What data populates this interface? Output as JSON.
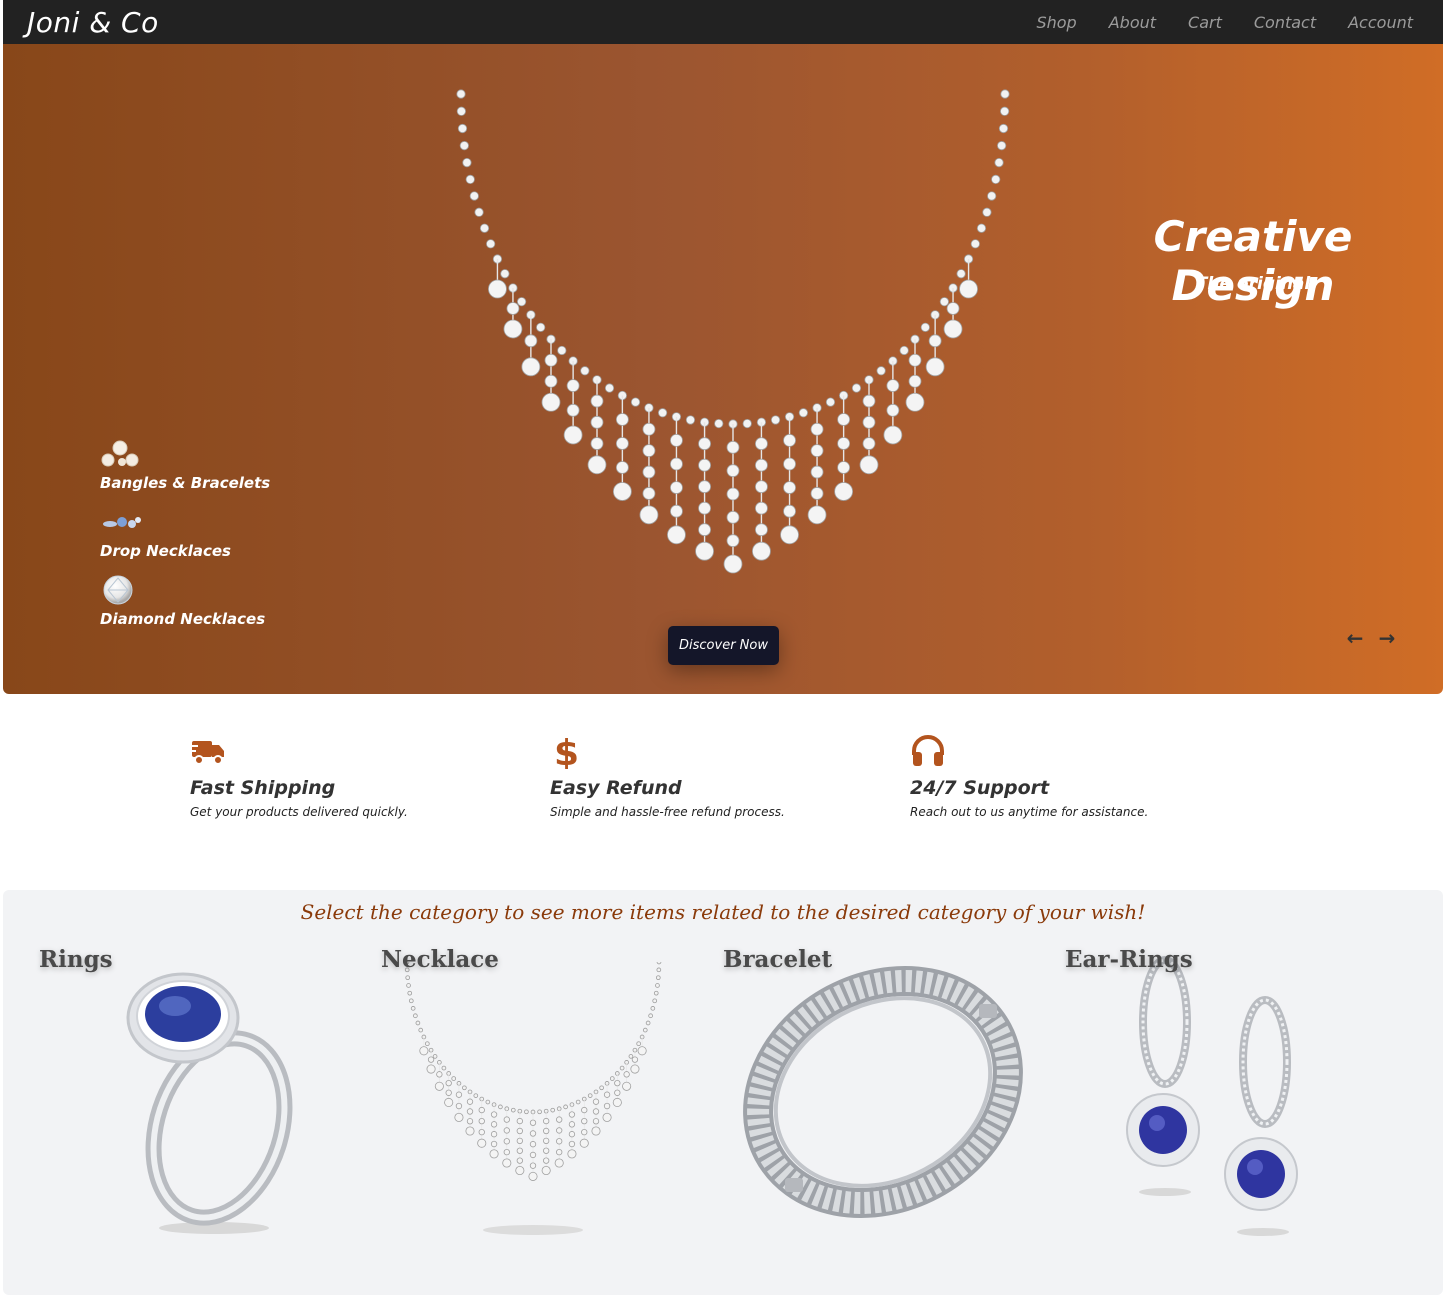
{
  "navbar": {
    "brand": "Joni & Co",
    "links": [
      "Shop",
      "About",
      "Cart",
      "Contact",
      "Account"
    ]
  },
  "hero": {
    "title": "Creative Design",
    "subtitle": "The original",
    "categories": [
      {
        "label": "Bangles & Bracelets",
        "icon": "pearls-icon"
      },
      {
        "label": "Drop Necklaces",
        "icon": "gem-cluster-icon"
      },
      {
        "label": "Diamond Necklaces",
        "icon": "diamond-icon"
      }
    ],
    "cta": "Discover Now",
    "prev_icon": "arrow-left-icon",
    "next_icon": "arrow-right-icon",
    "gradient": [
      "#884719",
      "#d06d26"
    ]
  },
  "features": [
    {
      "icon": "truck-icon",
      "title": "Fast Shipping",
      "text": "Get your products delivered quickly."
    },
    {
      "icon": "dollar-icon",
      "title": "Easy Refund",
      "text": "Simple and hassle-free refund process."
    },
    {
      "icon": "headphones-icon",
      "title": "24/7 Support",
      "text": "Reach out to us anytime for assistance."
    }
  ],
  "categories_section": {
    "header": "Select the category to see more items related to the desired category of your wish!",
    "items": [
      {
        "title": "Rings"
      },
      {
        "title": "Necklace"
      },
      {
        "title": "Bracelet"
      },
      {
        "title": "Ear-Rings"
      }
    ]
  },
  "colors": {
    "accent": "#b3541e",
    "navbar": "#222222",
    "button": "#141629",
    "header_text": "#8a3a0a"
  }
}
